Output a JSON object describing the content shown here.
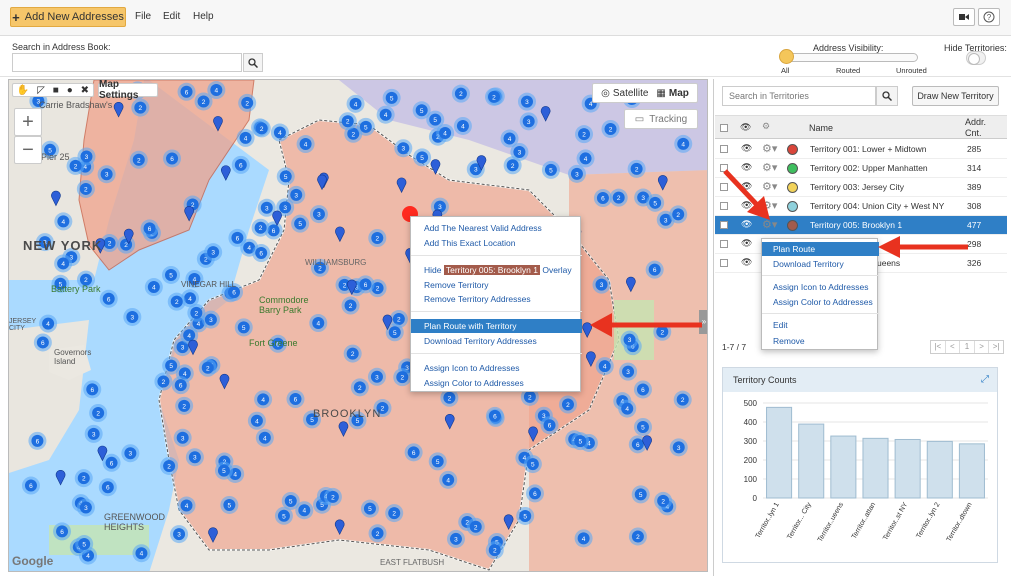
{
  "toolbar": {
    "add_label": "Add New Addresses",
    "menu": [
      "File",
      "Edit",
      "Help"
    ],
    "video_icon": "video-icon",
    "help_icon": "help-icon"
  },
  "search": {
    "label": "Search in Address Book:",
    "value": "",
    "button_icon": "search-icon"
  },
  "visibility": {
    "label": "Address Visibility:",
    "options": [
      "All",
      "Routed",
      "Unrouted"
    ],
    "level": 0,
    "hide_label": "Hide Territories:",
    "hide_on": false
  },
  "map": {
    "settings_label": "Map Settings",
    "satellite_label": "Satellite",
    "map_label": "Map",
    "tracking_label": "Tracking",
    "zoom_in": "+",
    "zoom_out": "−",
    "watermark": "Google",
    "places": [
      "Carrie Bradshaw's",
      "NEW YORK",
      "Pier 25",
      "Battery Park",
      "VINEGAR HILL",
      "Commodore Barry Park",
      "Fort Greene",
      "BROOKLYN",
      "Governors Island",
      "GREENWOOD HEIGHTS",
      "WILLIAMSBURG",
      "EAST FLATBUSH",
      "JERSEY CITY"
    ]
  },
  "context_menu": {
    "items": [
      {
        "label": "Add The Nearest Valid Address"
      },
      {
        "label": "Add This Exact Location"
      },
      {
        "label_pre": "Hide ",
        "label_tag": "Territory 005: Brooklyn 1",
        "label_post": " Overlay"
      },
      {
        "label": "Remove Territory"
      },
      {
        "label": "Remove Territory Addresses"
      },
      {
        "label": "Plan Route with Territory",
        "highlighted": true
      },
      {
        "label": "Download Territory Addresses"
      },
      {
        "label": "Assign Icon to Addresses"
      },
      {
        "label": "Assign Color to Addresses"
      }
    ]
  },
  "territories": {
    "search_placeholder": "Search in Territories",
    "draw_label": "Draw New Territory",
    "col_name": "Name",
    "col_addr": "Addr.",
    "col_cnt": "Cnt.",
    "rows": [
      {
        "name": "Territory 001: Lower + Midtown",
        "count": "285",
        "color": "#d9453a"
      },
      {
        "name": "Territory 002: Upper Manhatten",
        "count": "314",
        "color": "#3fbf5f"
      },
      {
        "name": "Territory 003: Jersey City",
        "count": "389",
        "color": "#f2d35a"
      },
      {
        "name": "Territory 004: Union City + West NY",
        "count": "308",
        "color": "#8fd1dc"
      },
      {
        "name": "Territory 005: Brooklyn 1",
        "count": "477",
        "color": "#a35b4b",
        "selected": true
      },
      {
        "name": "",
        "count": "298",
        "color": ""
      },
      {
        "name": "ueens",
        "count": "326",
        "color": ""
      }
    ],
    "pagination": "1-7 / 7",
    "pager_buttons": [
      "|<",
      "<",
      "1",
      ">",
      ">|"
    ]
  },
  "row_menu": {
    "items": [
      {
        "label": "Plan Route",
        "highlighted": true
      },
      {
        "label": "Download Territory"
      },
      {
        "label": "Assign Icon to Addresses"
      },
      {
        "label": "Assign Color to Addresses"
      },
      {
        "label": "Edit"
      },
      {
        "label": "Remove"
      }
    ]
  },
  "chart_data": {
    "type": "bar",
    "title": "Territory Counts",
    "categories": [
      "Territor..lyn 1",
      "Territor... City",
      "Territor..ueens",
      "Territor..attan",
      "Territor..st NY",
      "Territor..lyn 2",
      "Territor..dtown"
    ],
    "values": [
      477,
      389,
      326,
      314,
      308,
      298,
      285
    ],
    "yticks": [
      0,
      100,
      200,
      300,
      400,
      500
    ],
    "ylim": [
      0,
      500
    ],
    "bar_color": "#cfe0ec",
    "bar_stroke": "#9fbcd0"
  }
}
